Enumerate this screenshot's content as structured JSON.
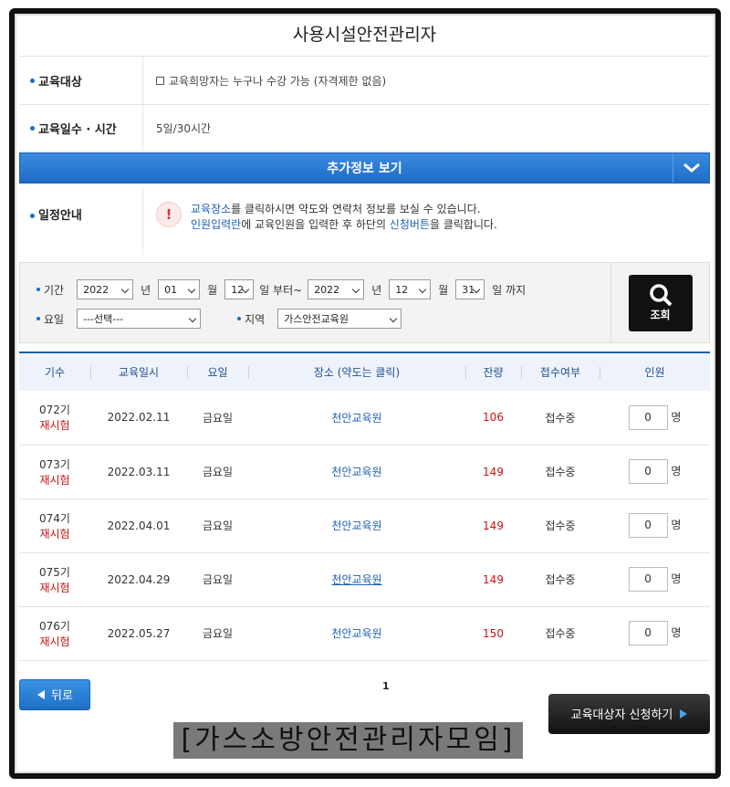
{
  "page_title": "사용시설안전관리자",
  "info": {
    "target_label": "교육대상",
    "target_value": "교육희망자는 누구나 수강 가능 (자격제한 없음)",
    "days_label": "교육일수 · 시간",
    "days_value": "5일/30시간"
  },
  "more_info_label": "추가정보 보기",
  "schedule": {
    "label": "일정안내",
    "line1_link": "교육장소",
    "line1_rest": "를 클릭하시면 약도와 연락처 정보를 보실 수 있습니다.",
    "line2_link1": "인원입력란",
    "line2_mid": "에 교육인원을 입력한 후 하단의 ",
    "line2_link2": "신청버튼",
    "line2_end": "을 클릭합니다."
  },
  "search": {
    "period_label": "기간",
    "from_year": "2022",
    "year_unit": "년",
    "from_month": "01",
    "month_unit": "월",
    "from_day": "12",
    "from_suffix": "일 부터~",
    "to_year": "2022",
    "to_month": "12",
    "to_day": "31",
    "to_suffix": "일 까지",
    "weekday_label": "요일",
    "weekday_value": "---선택---",
    "region_label": "지역",
    "region_value": "가스안전교육원",
    "button_label": "조회"
  },
  "table": {
    "headers": [
      "기수",
      "교육일시",
      "요일",
      "장소 (약도는 클릭)",
      "잔량",
      "접수여부",
      "인원"
    ],
    "rows": [
      {
        "term": "072기",
        "retest": "재시험",
        "date": "2022.02.11",
        "day": "금요일",
        "place": "천안교육원",
        "remain": "106",
        "status": "접수중",
        "qty": "0",
        "unit": "명"
      },
      {
        "term": "073기",
        "retest": "재시험",
        "date": "2022.03.11",
        "day": "금요일",
        "place": "천안교육원",
        "remain": "149",
        "status": "접수중",
        "qty": "0",
        "unit": "명"
      },
      {
        "term": "074기",
        "retest": "재시험",
        "date": "2022.04.01",
        "day": "금요일",
        "place": "천안교육원",
        "remain": "149",
        "status": "접수중",
        "qty": "0",
        "unit": "명"
      },
      {
        "term": "075기",
        "retest": "재시험",
        "date": "2022.04.29",
        "day": "금요일",
        "place": "천안교육원",
        "remain": "149",
        "status": "접수중",
        "qty": "0",
        "unit": "명"
      },
      {
        "term": "076기",
        "retest": "재시험",
        "date": "2022.05.27",
        "day": "금요일",
        "place": "천안교육원",
        "remain": "150",
        "status": "접수중",
        "qty": "0",
        "unit": "명"
      }
    ]
  },
  "back_label": "뒤로",
  "page_number": "1",
  "apply_label": "교육대상자 신청하기",
  "watermark": "[가스소방안전관리자모임]"
}
